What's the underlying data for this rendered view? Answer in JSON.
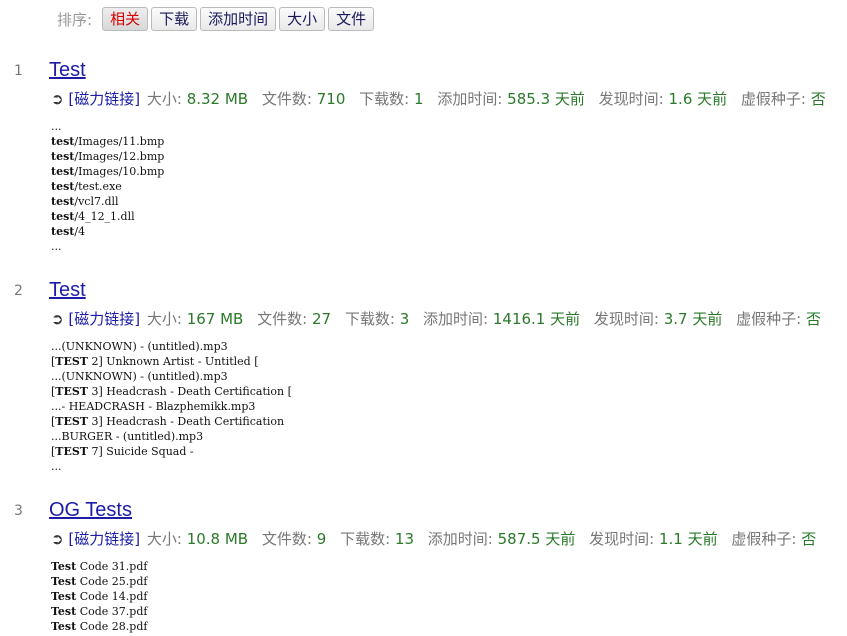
{
  "sort": {
    "label": "排序:",
    "options": [
      {
        "label": "相关",
        "active": true
      },
      {
        "label": "下载",
        "active": false
      },
      {
        "label": "添加时间",
        "active": false
      },
      {
        "label": "大小",
        "active": false
      },
      {
        "label": "文件",
        "active": false
      }
    ]
  },
  "results": [
    {
      "index": "1",
      "title": "Test",
      "magnet": "[磁力链接]",
      "size_label": "大小:",
      "size": "8.32 MB",
      "files_label": "文件数:",
      "files": "710",
      "downloads_label": "下载数:",
      "downloads": "1",
      "added_label": "添加时间:",
      "added": "585.3 天前",
      "found_label": "发现时间:",
      "found": "1.6 天前",
      "fake_label": "虚假种子:",
      "fake": "否",
      "file_list": [
        {
          "bold": "",
          "rest": "..."
        },
        {
          "bold": "test",
          "rest": "/Images/11.bmp"
        },
        {
          "bold": "test",
          "rest": "/Images/12.bmp"
        },
        {
          "bold": "test",
          "rest": "/Images/10.bmp"
        },
        {
          "bold": "test",
          "rest": "/test.exe"
        },
        {
          "bold": "test",
          "rest": "/vcl7.dll"
        },
        {
          "bold": "test",
          "rest": "/4_12_1.dll"
        },
        {
          "bold": "test",
          "rest": "/4"
        },
        {
          "bold": "",
          "rest": "..."
        }
      ]
    },
    {
      "index": "2",
      "title": "Test",
      "magnet": "[磁力链接]",
      "size_label": "大小:",
      "size": "167 MB",
      "files_label": "文件数:",
      "files": "27",
      "downloads_label": "下载数:",
      "downloads": "3",
      "added_label": "添加时间:",
      "added": "1416.1 天前",
      "found_label": "发现时间:",
      "found": "3.7 天前",
      "fake_label": "虚假种子:",
      "fake": "否",
      "file_list": [
        {
          "bold": "",
          "rest": "...(UNKNOWN) - (untitled).mp3"
        },
        {
          "pre": "[",
          "bold": "TEST",
          "rest": " 2] Unknown Artist - Untitled ["
        },
        {
          "bold": "",
          "rest": "...(UNKNOWN) - (untitled).mp3"
        },
        {
          "pre": "[",
          "bold": "TEST",
          "rest": " 3] Headcrash - Death Certification ["
        },
        {
          "bold": "",
          "rest": "...- HEADCRASH - Blazphemikk.mp3"
        },
        {
          "pre": "[",
          "bold": "TEST",
          "rest": " 3] Headcrash - Death Certification"
        },
        {
          "bold": "",
          "rest": "...BURGER - (untitled).mp3"
        },
        {
          "pre": "[",
          "bold": "TEST",
          "rest": " 7] Suicide Squad -"
        },
        {
          "bold": "",
          "rest": "..."
        }
      ]
    },
    {
      "index": "3",
      "title": "OG Tests",
      "magnet": "[磁力链接]",
      "size_label": "大小:",
      "size": "10.8 MB",
      "files_label": "文件数:",
      "files": "9",
      "downloads_label": "下载数:",
      "downloads": "13",
      "added_label": "添加时间:",
      "added": "587.5 天前",
      "found_label": "发现时间:",
      "found": "1.1 天前",
      "fake_label": "虚假种子:",
      "fake": "否",
      "file_list": [
        {
          "bold": "Test",
          "rest": " Code 31.pdf"
        },
        {
          "bold": "Test",
          "rest": " Code 25.pdf"
        },
        {
          "bold": "Test",
          "rest": " Code 14.pdf"
        },
        {
          "bold": "Test",
          "rest": " Code 37.pdf"
        },
        {
          "bold": "Test",
          "rest": " Code 28.pdf"
        }
      ]
    }
  ]
}
